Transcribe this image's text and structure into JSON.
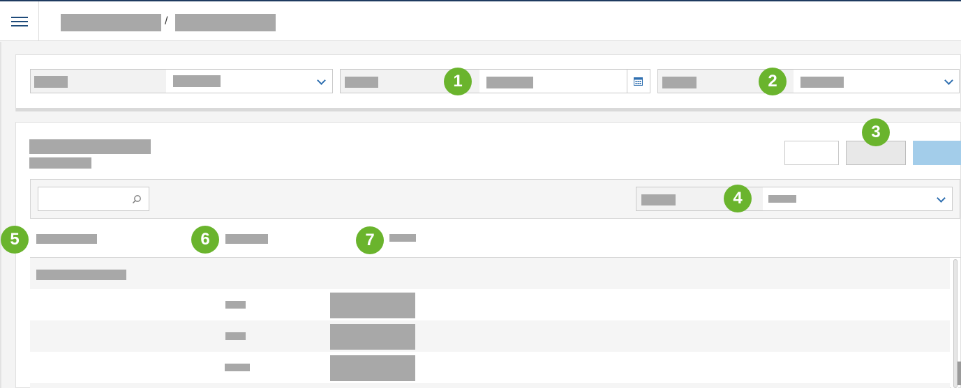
{
  "topbar": {
    "menu_icon": "hamburger-menu-icon",
    "breadcrumb_separator": "/"
  },
  "markers": [
    "1",
    "2",
    "3",
    "4",
    "5",
    "6",
    "7"
  ],
  "icons": {
    "calendar": "calendar-icon",
    "search": "search-icon",
    "dropdown": "chevron-down-icon"
  },
  "colors": {
    "marker": "#6ab42d",
    "accent": "#2f6fb0",
    "primary_button": "#a3cdea",
    "header_line": "#1e3a5f"
  }
}
